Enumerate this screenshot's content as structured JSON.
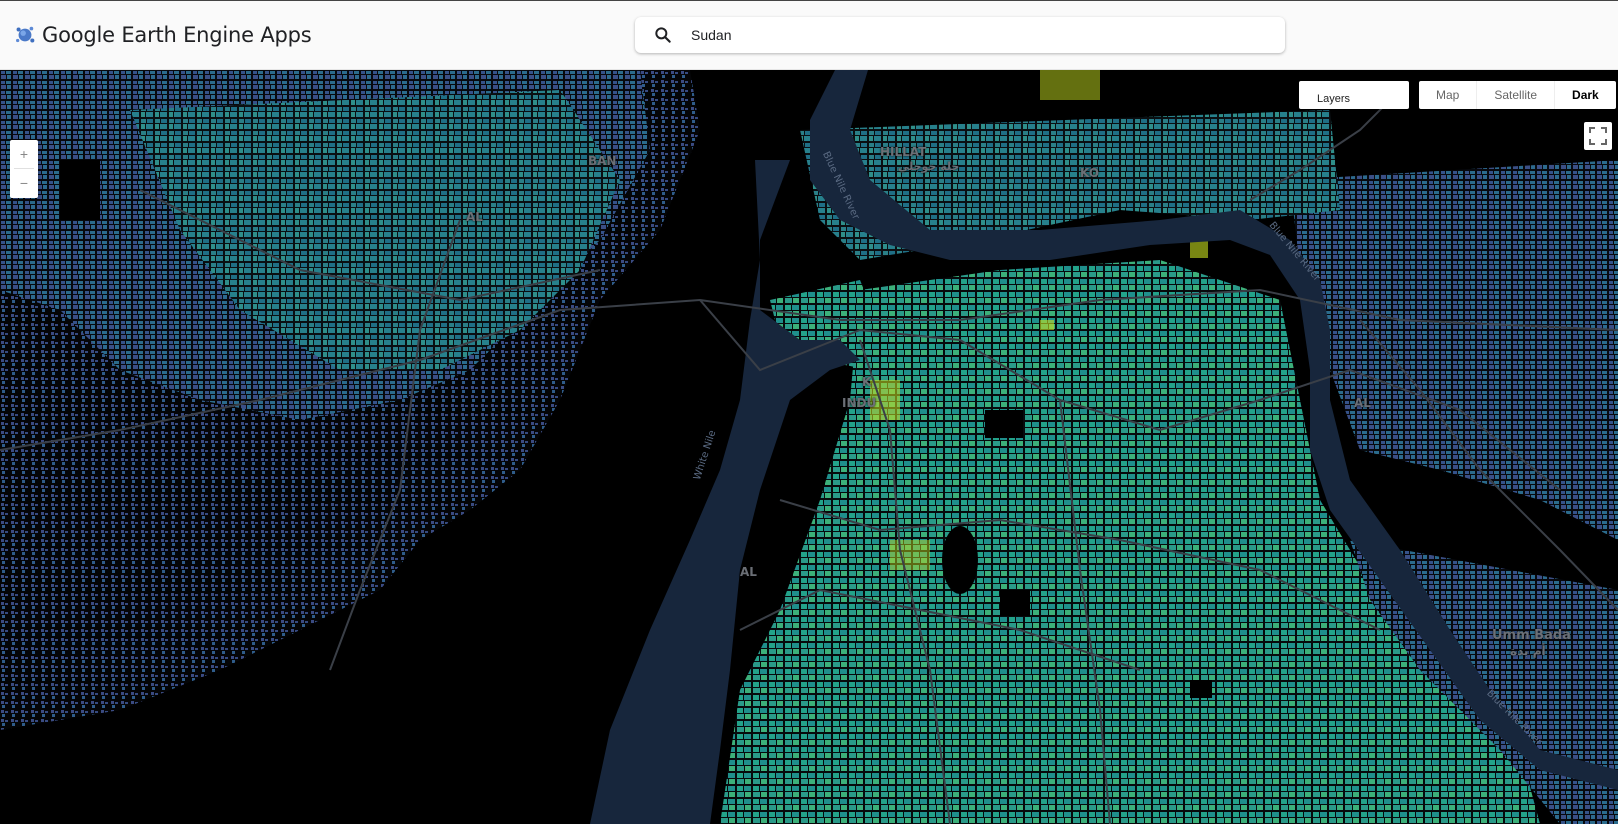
{
  "header": {
    "app_title": "Google Earth Engine Apps",
    "logo_icon": "earth-engine-logo-icon"
  },
  "search": {
    "value": "Sudan",
    "icon": "search-icon"
  },
  "map": {
    "zoom_in_label": "+",
    "zoom_out_label": "−",
    "layers_label": "Layers",
    "map_types": [
      "Map",
      "Satellite",
      "Dark"
    ],
    "active_map_type": "Dark",
    "fullscreen_icon": "fullscreen-icon",
    "place_labels": [
      "BAN",
      "HILLAT",
      "حلة خوجلي",
      "KO",
      "AL",
      "INDU",
      "AL",
      "AL",
      "Umm Bada",
      "أم بدة",
      "K"
    ],
    "river_labels": [
      "Blue Nile River",
      "Blue Nile River",
      "White Nile",
      "Blue Nile River"
    ],
    "colors": {
      "background": "#000000",
      "water": "#17263c",
      "roads": "#3a3f47",
      "ramp_low": "#3b528b",
      "ramp_mid": "#21918c",
      "ramp_high": "#c8e020"
    }
  }
}
